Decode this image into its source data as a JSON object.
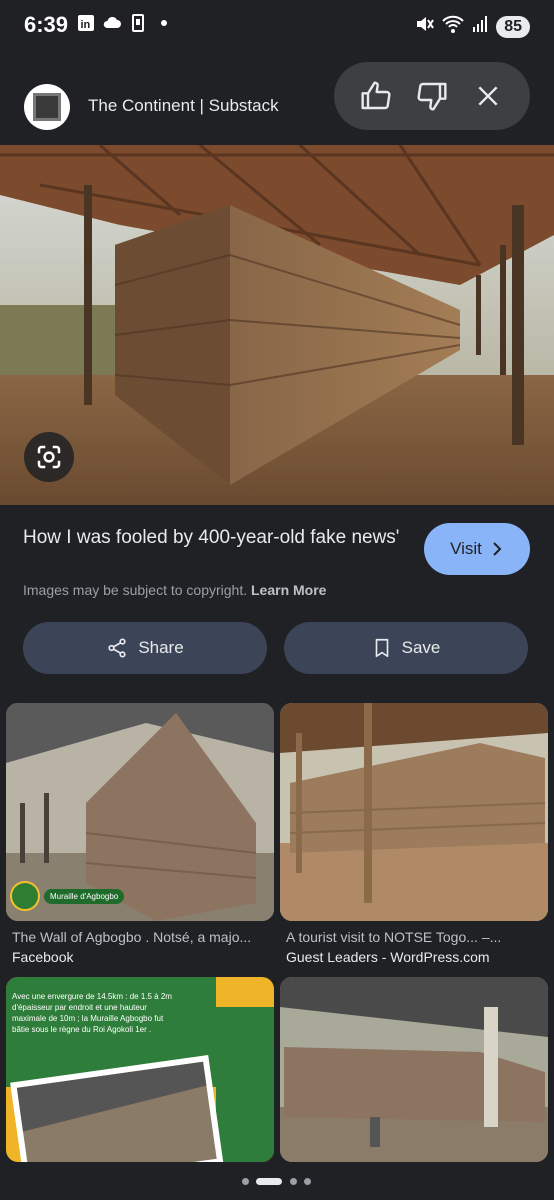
{
  "status_bar": {
    "time": "6:39",
    "battery": "85",
    "left_icons": [
      "linkedin-icon",
      "cloud-icon",
      "device-icon",
      "dot-icon"
    ],
    "right_icons": [
      "mute-icon",
      "wifi-icon",
      "signal-icon"
    ]
  },
  "header": {
    "site_name": "The Continent | Substack",
    "actions": [
      "thumbs-up-icon",
      "thumbs-down-icon",
      "close-icon"
    ]
  },
  "main": {
    "title": "How I was fooled by 400-year-old fake news'",
    "visit_label": "Visit",
    "copyright_text": "Images may be subject to copyright.",
    "learn_more": "Learn More",
    "share_label": "Share",
    "save_label": "Save"
  },
  "results": [
    {
      "title": "The Wall of Agbogbo . Notsé, a majo...",
      "source": "Facebook",
      "badge": "Muraille d'Agbogbo"
    },
    {
      "title": "A tourist visit to NOTSE Togo... –...",
      "source": "Guest Leaders - WordPress.com"
    },
    {
      "title": "",
      "source": "",
      "overlay_text": "Avec une envergure de 14.5km : de 1.5 à 2m d'épaisseur par endroit et une hauteur maximale de 10m ; la Muraille Agbogbo fut bâtie sous le règne du Roi Agokoli 1er ."
    },
    {
      "title": "",
      "source": ""
    }
  ],
  "colors": {
    "background": "#202124",
    "visit_button": "#8ab4f8",
    "action_button": "#3c4557",
    "feedback_pill": "#3c4043"
  }
}
